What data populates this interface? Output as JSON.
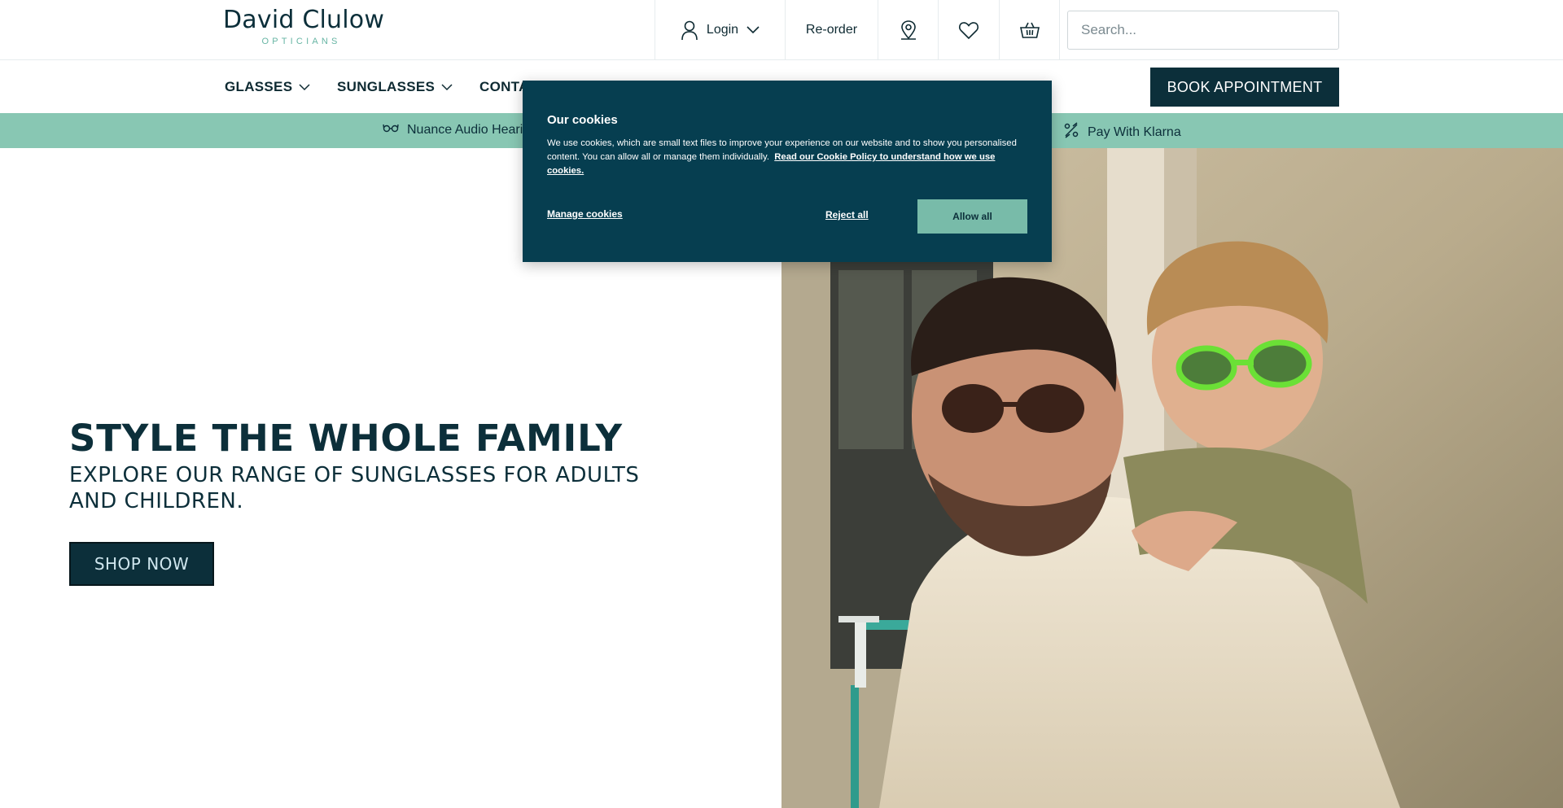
{
  "header": {
    "logo_name": "David Clulow",
    "logo_sub": "OPTICIANS",
    "login_label": "Login",
    "reorder_label": "Re-order",
    "icons": [
      "user-icon",
      "chevron-down-icon",
      "store-locator-icon",
      "heart-icon",
      "basket-icon"
    ],
    "search_placeholder": "Search..."
  },
  "nav": {
    "items": [
      {
        "label": "GLASSES",
        "dropdown": true
      },
      {
        "label": "SUNGLASSES",
        "dropdown": true
      },
      {
        "label": "CONTA",
        "dropdown": false
      }
    ],
    "book_label": "BOOK APPOINTMENT"
  },
  "promo": {
    "items": [
      {
        "label": "Nuance Audio Heari",
        "icon": "glasses-icon"
      },
      {
        "label": "Pay With Klarna",
        "icon": "klarna-icon"
      }
    ]
  },
  "hero": {
    "title": "STYLE THE WHOLE FAMILY",
    "subtitle": "EXPLORE OUR RANGE OF SUNGLASSES FOR ADULTS AND CHILDREN.",
    "button_label": "SHOP NOW"
  },
  "cookie": {
    "title": "Our cookies",
    "body": "We use cookies, which are small text files to improve your experience on our website and to show you personalised content. You can allow all or manage them individually.",
    "policy_link": "Read our Cookie Policy to understand how we use cookies.",
    "manage_label": "Manage cookies",
    "reject_label": "Reject all",
    "allow_label": "Allow all"
  },
  "colors": {
    "primary": "#0c2f3a",
    "cookie_bg": "#063e50",
    "accent": "#88c7b3",
    "allow_button": "#78bba9"
  }
}
